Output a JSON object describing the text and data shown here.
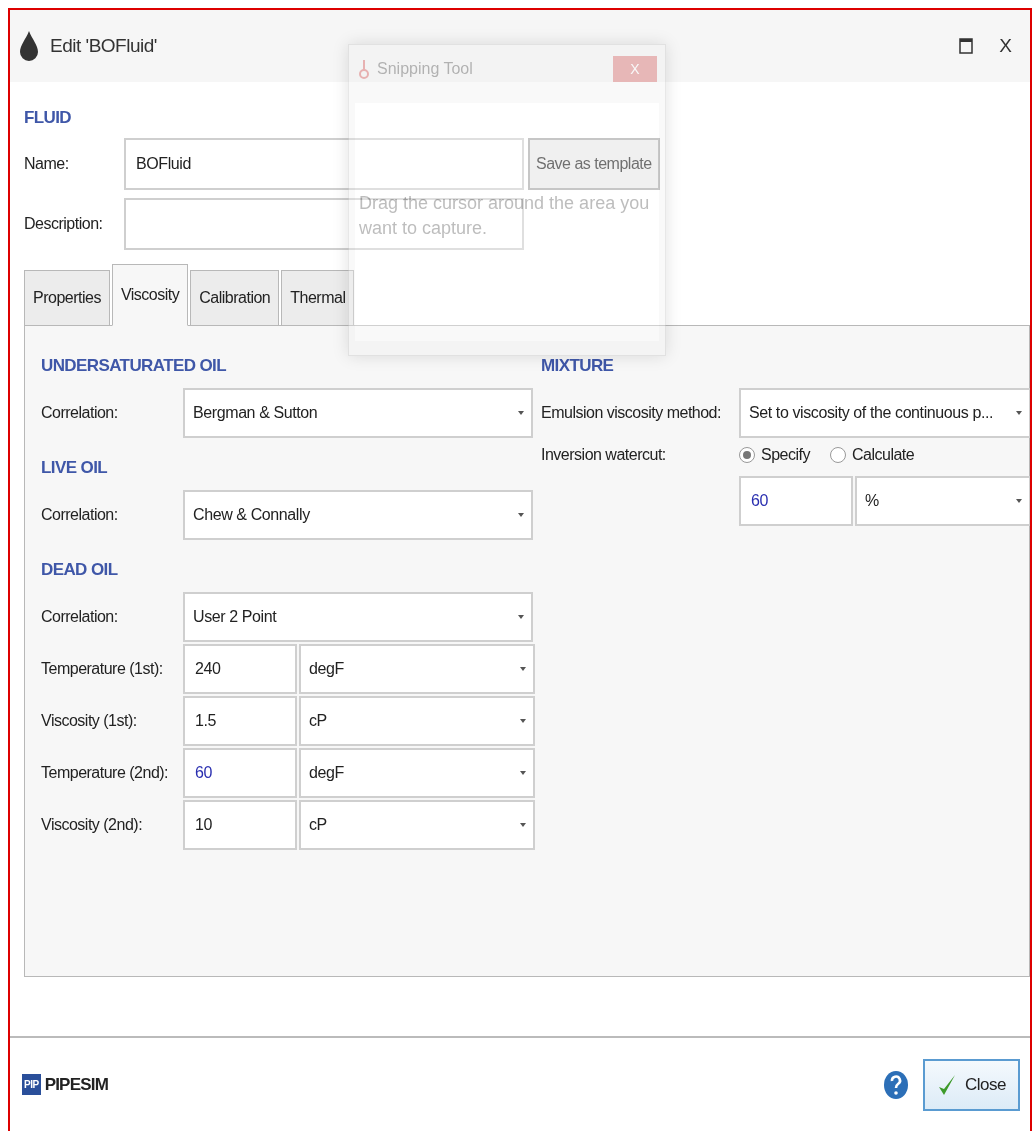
{
  "window": {
    "title": "Edit 'BOFluid'",
    "close_glyph": "X"
  },
  "fluid": {
    "heading": "FLUID",
    "name_label": "Name:",
    "name_value": "BOFluid",
    "save_button": "Save as template",
    "description_label": "Description:"
  },
  "tabs": [
    {
      "label": "Properties",
      "selected": false
    },
    {
      "label": "Viscosity",
      "selected": true
    },
    {
      "label": "Calibration",
      "selected": false
    },
    {
      "label": "Thermal",
      "selected": false
    }
  ],
  "left_sections": [
    {
      "heading": "UNDERSATURATED OIL",
      "rows": [
        {
          "kind": "select",
          "label": "Correlation:",
          "value": "Bergman & Sutton"
        }
      ]
    },
    {
      "heading": "LIVE OIL",
      "rows": [
        {
          "kind": "select",
          "label": "Correlation:",
          "value": "Chew & Connally"
        }
      ]
    },
    {
      "heading": "DEAD OIL",
      "rows": [
        {
          "kind": "select",
          "label": "Correlation:",
          "value": "User 2 Point"
        },
        {
          "kind": "quantity",
          "label": "Temperature (1st):",
          "value": "240",
          "default": false,
          "unit": "degF"
        },
        {
          "kind": "quantity",
          "label": "Viscosity (1st):",
          "value": "1.5",
          "default": false,
          "unit": "cP"
        },
        {
          "kind": "quantity",
          "label": "Temperature (2nd):",
          "value": "60",
          "default": true,
          "unit": "degF"
        },
        {
          "kind": "quantity",
          "label": "Viscosity (2nd):",
          "value": "10",
          "default": false,
          "unit": "cP"
        }
      ]
    }
  ],
  "mixture": {
    "heading": "MIXTURE",
    "method_label": "Emulsion viscosity method:",
    "method_value": "Set to viscosity of the continuous p...",
    "watercut_label": "Inversion watercut:",
    "watercut_options": [
      {
        "label": "Specify",
        "selected": true
      },
      {
        "label": "Calculate",
        "selected": false
      }
    ],
    "watercut_value": "60",
    "watercut_default": true,
    "watercut_unit": "%"
  },
  "snipping_tool": {
    "title": "Snipping Tool",
    "close_glyph": "X",
    "message": "Drag the cursor around the area you want to capture."
  },
  "footer": {
    "logo_badge": "PIP",
    "brand": "PIPESIM",
    "close_button": "Close"
  }
}
